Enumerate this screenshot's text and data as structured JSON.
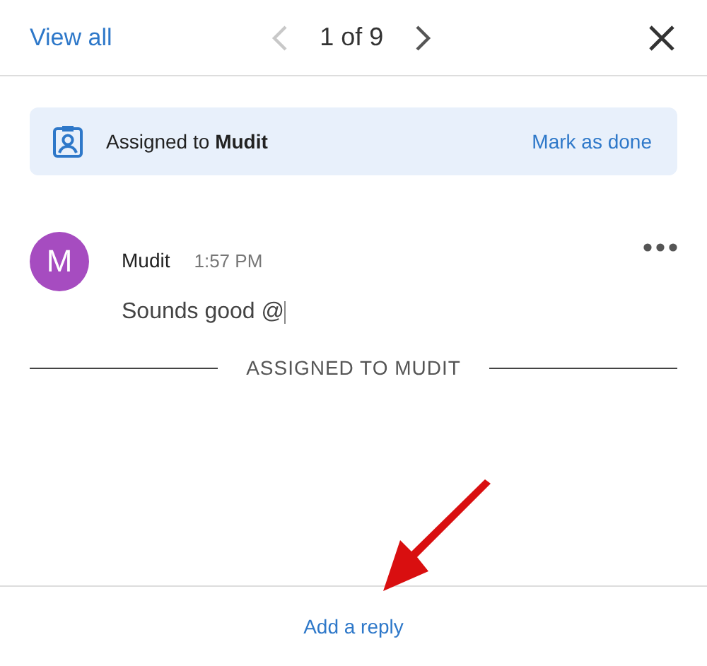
{
  "header": {
    "view_all": "View all",
    "prev": {
      "disabled": true
    },
    "counter": "1 of 9",
    "next": {
      "disabled": false
    }
  },
  "banner": {
    "text": "Assigned to **Mudit**",
    "action": "Mark as done"
  },
  "comment": {
    "avatar": {
      "text": "M",
      "color": "#a64cc0"
    },
    "author": "Mudit",
    "time": "1:57 PM",
    "body": "Sounds good @",
    "editing": true
  },
  "divider": "ASSIGNED TO MUDIT",
  "footer": {
    "reply": "Add a reply"
  }
}
